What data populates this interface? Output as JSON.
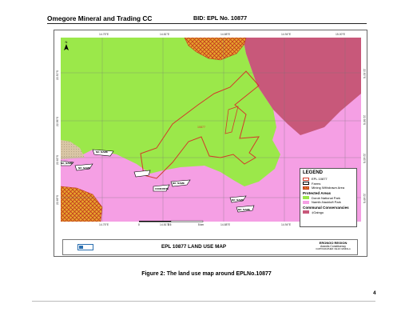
{
  "header": {
    "company": "Omegore Mineral and Trading CC",
    "bid": "BID: EPL No. 10877"
  },
  "map": {
    "top_coords": [
      "14.75°E",
      "14.81°E",
      "14.88°E",
      "14.94°E",
      "15.00°E"
    ],
    "bottom_coords": [
      "14.75°E",
      "14.81°E",
      "14.88°E",
      "14.94°E",
      "15.00°E"
    ],
    "left_coords": [
      "22.50°S",
      "22.56°S",
      "22.63°S",
      "22.69°S"
    ],
    "right_coords": [
      "22.50°S",
      "22.56°S",
      "22.63°S",
      "22.69°S"
    ],
    "epl_label": "10877",
    "farm_labels": [
      "NO_NAME",
      "NO_NAME",
      "NO_NAME",
      "NO_NAME",
      "NO_NAME",
      "NO_NAME",
      "CONKONTE"
    ],
    "north_symbol": "N",
    "colors": {
      "dorob": "#9be84a",
      "namib": "#f59fe4",
      "conservancy": "#c8587a",
      "epl": "#d23a2a",
      "mining": "#e84a30"
    }
  },
  "legend": {
    "title": "LEGEND",
    "items": [
      {
        "label": "EPL 10877"
      },
      {
        "label": "Farms"
      },
      {
        "label": "Mining Withdrawn Area"
      }
    ],
    "protected_heading": "Protected Areas",
    "protected_items": [
      {
        "label": "Dorob National Park"
      },
      {
        "label": "Namib-Naukluft Park"
      }
    ],
    "communal_heading": "Communal Conservancies",
    "communal_items": [
      {
        "label": "‡Gaingu"
      }
    ]
  },
  "scalebar": {
    "labels": [
      "0",
      "2.5",
      "5 km"
    ]
  },
  "titlebar": {
    "map_title": "EPL 10877 LAND USE MAP",
    "region": "ERONGO REGION",
    "constituency": "Arandis Constituency",
    "cartographer": "CARTOGRAPHER: NEJAI NAMFALA"
  },
  "caption": "Figure 2: The land use map around EPLNo.10877",
  "page_number": "4"
}
